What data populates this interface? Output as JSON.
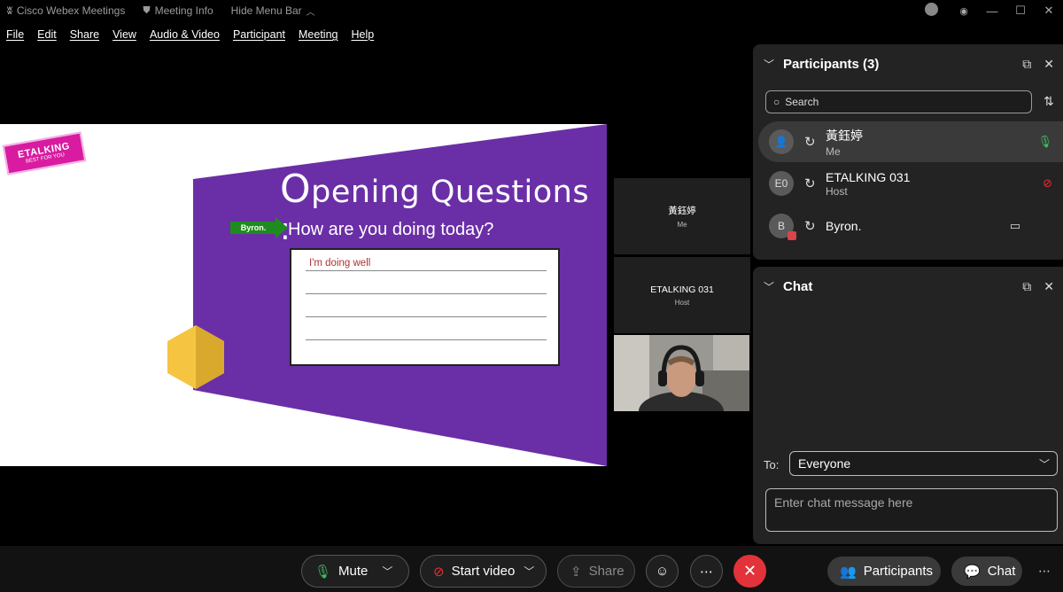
{
  "titlebar": {
    "app_title": "Cisco Webex Meetings",
    "meeting_info": "Meeting Info",
    "hide_menu_bar": "Hide Menu Bar"
  },
  "menu": [
    "File",
    "Edit",
    "Share",
    "View",
    "Audio & Video",
    "Participant",
    "Meeting",
    "Help"
  ],
  "slide": {
    "logo_text": "ETALKING",
    "logo_sub": "BEST FOR YOU",
    "title_first_letter": "O",
    "title_rest": "pening Questions :",
    "tag": "Byron.",
    "question": "How are you doing today?",
    "answer": "I'm doing well"
  },
  "tiles": [
    {
      "name": "黃鈺婷",
      "sub": "Me"
    },
    {
      "name": "ETALKING 031",
      "sub": "Host"
    }
  ],
  "participants": {
    "title": "Participants (3)",
    "search_placeholder": "Search",
    "list": [
      {
        "initials": "",
        "name": "黃鈺婷",
        "role": "Me",
        "status": "mic-on-icon"
      },
      {
        "initials": "E0",
        "name": "ETALKING 031",
        "role": "Host",
        "status": "mic-muted-icon"
      },
      {
        "initials": "B",
        "name": "Byron.",
        "role": "",
        "status": "video-icon"
      }
    ]
  },
  "chat": {
    "title": "Chat",
    "to_label": "To:",
    "to_value": "Everyone",
    "input_placeholder": "Enter chat message here"
  },
  "toolbar": {
    "mute": "Mute",
    "start_video": "Start video",
    "share": "Share",
    "participants": "Participants",
    "chat": "Chat"
  },
  "colors": {
    "slide_purple": "#6a2fa6",
    "hexagon": "#f5c542",
    "end_button": "#e2323a",
    "mic_active": "#3fbf5f",
    "mic_muted": "#e2323a"
  }
}
